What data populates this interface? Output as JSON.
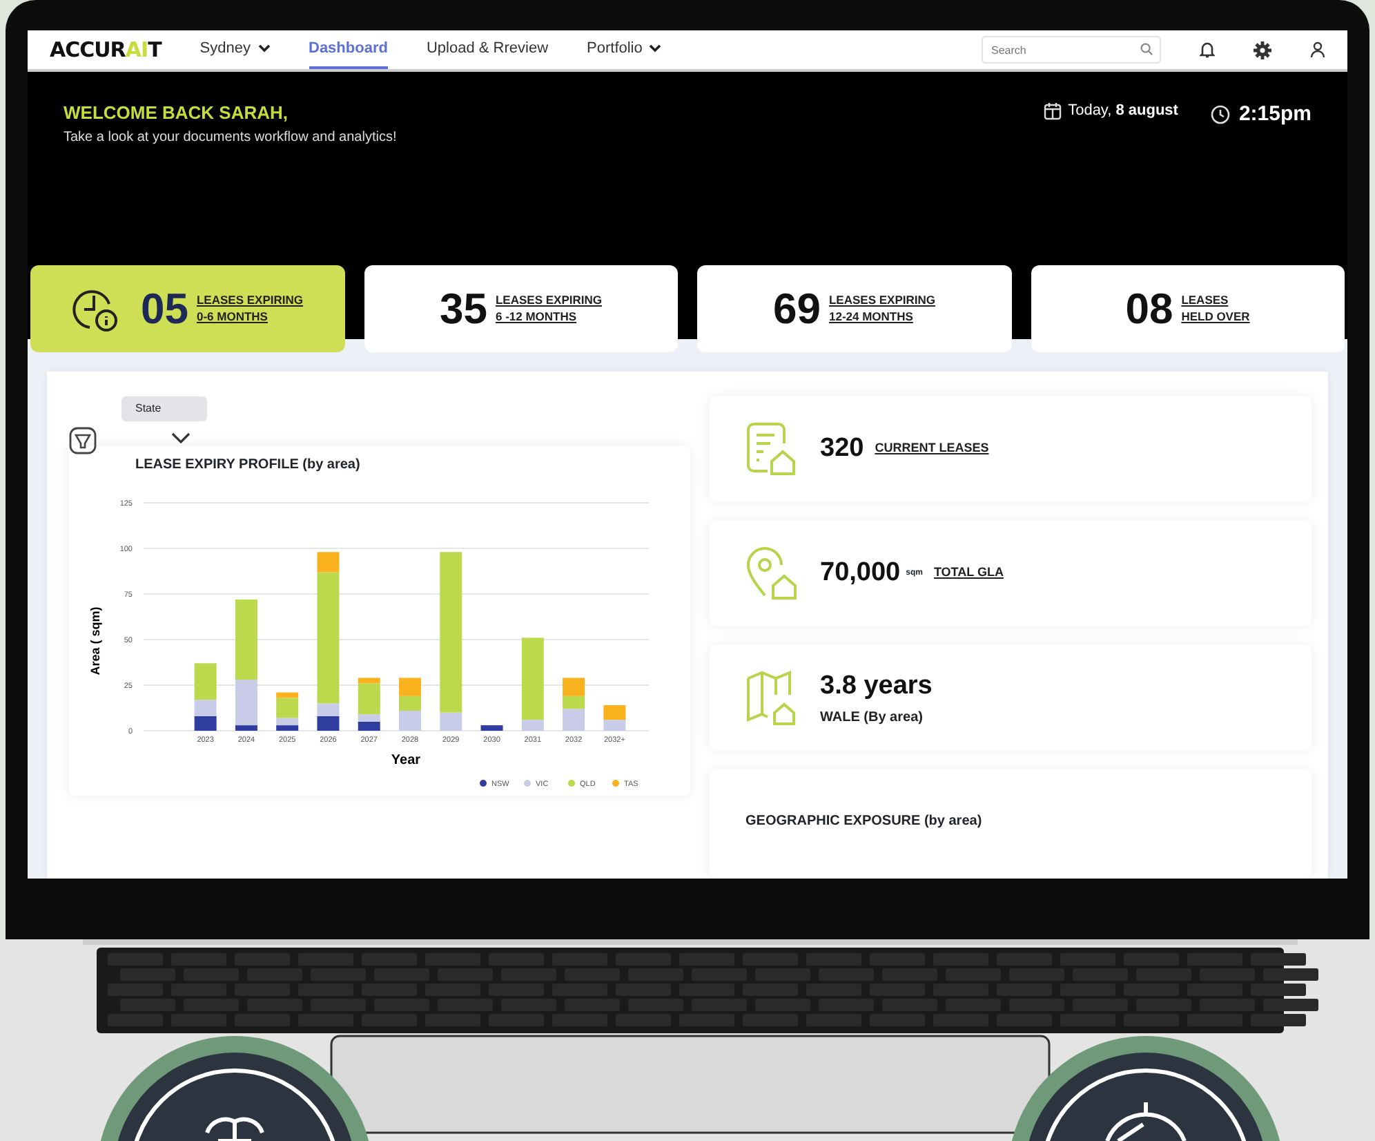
{
  "nav": {
    "logo_start": "ACCUR",
    "logo_highlight": "AI",
    "logo_end": "T",
    "items": [
      {
        "label": "Sydney",
        "kind": "dropdown",
        "selected": false
      },
      {
        "label": "Dashboard",
        "kind": "link",
        "selected": true
      },
      {
        "label": "Upload & Rreview",
        "kind": "link",
        "selected": false
      },
      {
        "label": "Portfolio",
        "kind": "dropdown",
        "selected": false
      }
    ],
    "search": {
      "placeholder": "Search"
    }
  },
  "header": {
    "greeting": "WELCOME BACK SARAH,",
    "subtitle": "Take a look at your documents workflow and analytics!",
    "date": "Today, **8 august**",
    "time": "2:15pm"
  },
  "stats": [
    {
      "value": "05",
      "line_1": "LEASES EXPIRING",
      "line_2": "0-6 MONTHS",
      "selected": true
    },
    {
      "value": "35",
      "line_1": "LEASES EXPIRING",
      "line_2": "6 -12 MONTHS",
      "selected": false
    },
    {
      "value": "69",
      "line_1": "LEASES EXPIRING",
      "line_2": "12-24 MONTHS",
      "selected": false
    },
    {
      "value": "08",
      "line_1": "LEASES",
      "line_2": "HELD OVER",
      "selected": false
    }
  ],
  "filter": {
    "label": "State"
  },
  "chart": {
    "chart_data": {
      "type": "bar",
      "title": "LEASE EXPIRY PROFILE  (by area)",
      "xlabel": "Year",
      "ylabel": "Area ( sqm)",
      "stacked": true,
      "categories": [
        "2023",
        "2024",
        "2025",
        "2026",
        "2027",
        "2028",
        "2029",
        "2030",
        "2031",
        "2032",
        "2032+"
      ],
      "series": [
        {
          "name": "NSW",
          "color": "#2e3d9e",
          "values": [
            8,
            3,
            3,
            8,
            5,
            0,
            0,
            3,
            0,
            0,
            0
          ]
        },
        {
          "name": "VIC",
          "color": "#c9cce8",
          "values": [
            9,
            25,
            4,
            7,
            4,
            11,
            10,
            0,
            6,
            12,
            6
          ]
        },
        {
          "name": "QLD",
          "color": "#bcd84c",
          "values": [
            20,
            44,
            11,
            72,
            17,
            8,
            88,
            0,
            45,
            7,
            0
          ]
        },
        {
          "name": "TAS",
          "color": "#f9b21d",
          "values": [
            0,
            0,
            3,
            11,
            3,
            10,
            0,
            0,
            0,
            10,
            8
          ]
        }
      ],
      "ylim": [
        0,
        125
      ],
      "yticks": [
        0,
        25,
        50,
        75,
        100,
        125
      ],
      "grid": true,
      "legend": true
    }
  },
  "kpis": [
    {
      "kind": "inline",
      "value": "320",
      "label": "CURRENT LEASES"
    },
    {
      "kind": "inline",
      "value": "70,000",
      "unit": "sqm",
      "label": "TOTAL GLA"
    },
    {
      "kind": "stacked",
      "value": "3.8 years",
      "label": "WALE  (By area)"
    }
  ],
  "geo": {
    "title": "GEOGRAPHIC EXPOSURE (by area)"
  }
}
